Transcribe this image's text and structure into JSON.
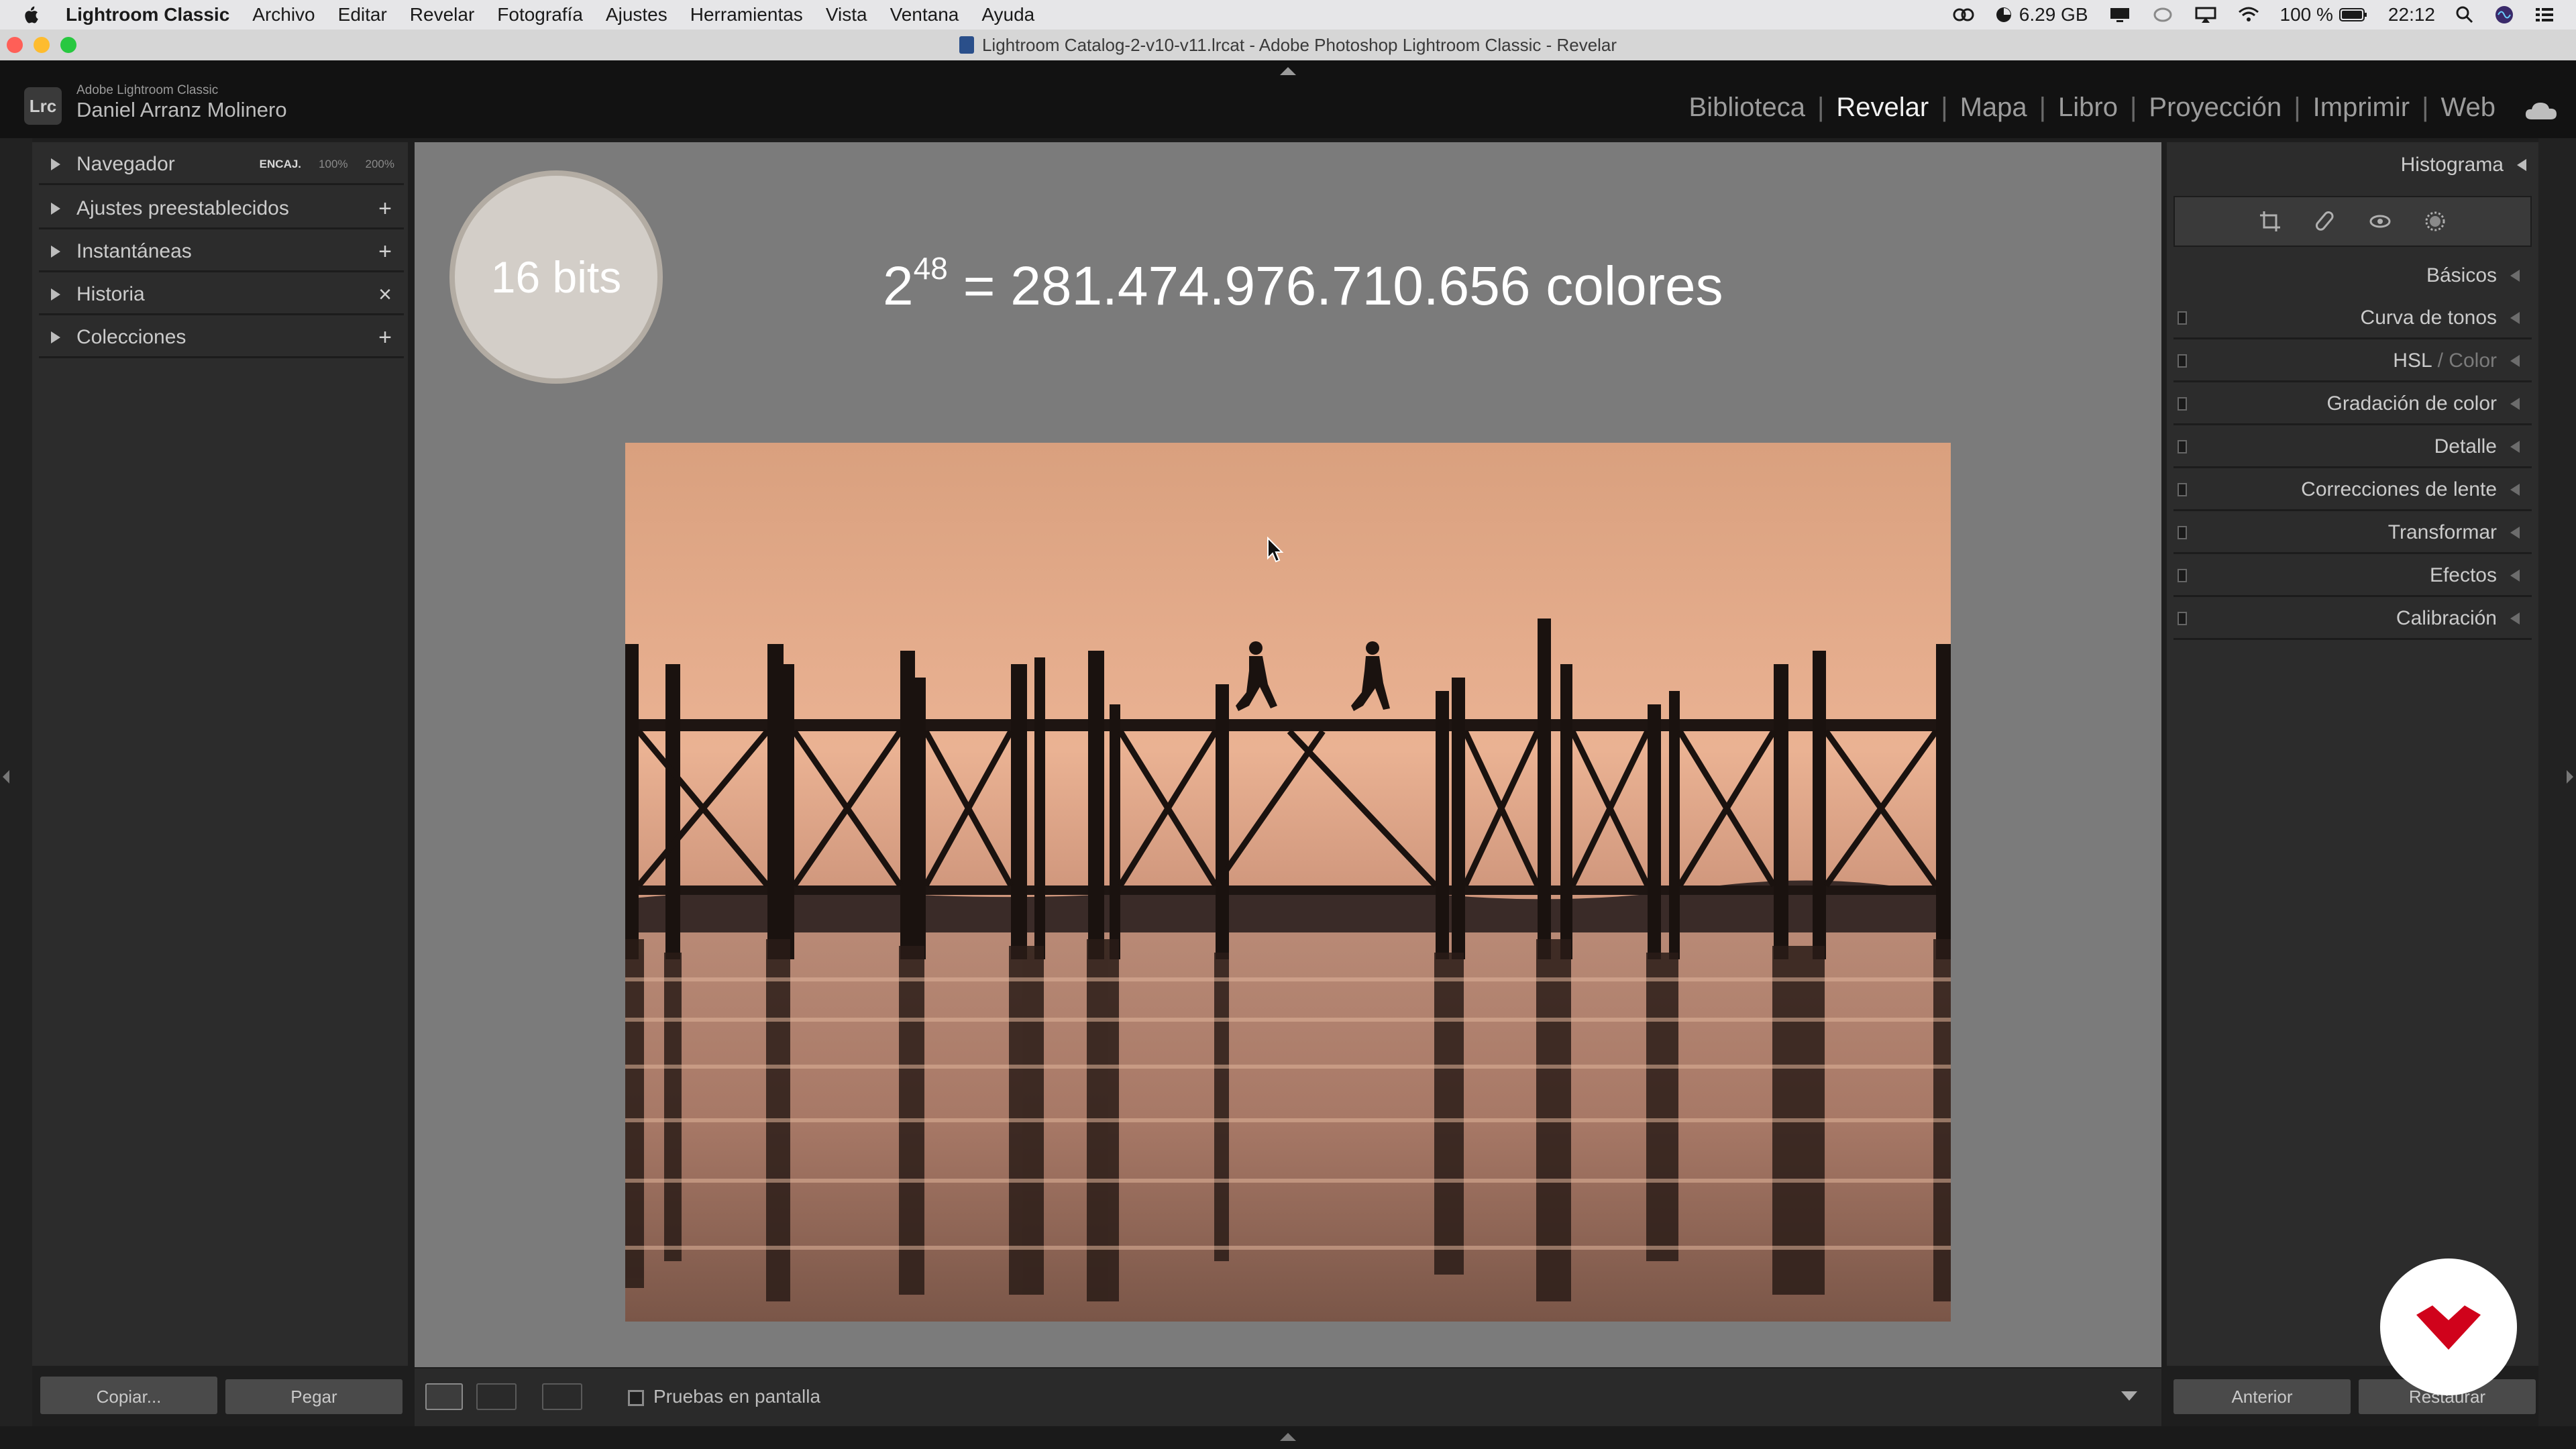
{
  "menubar": {
    "items": [
      "Lightroom Classic",
      "Archivo",
      "Editar",
      "Revelar",
      "Fotografía",
      "Ajustes",
      "Herramientas",
      "Vista",
      "Ventana",
      "Ayuda"
    ],
    "memory": "6.29 GB",
    "battery": "100 %",
    "time": "22:12"
  },
  "window": {
    "title": "Lightroom Catalog-2-v10-v11.lrcat - Adobe Photoshop Lightroom Classic - Revelar"
  },
  "identity": {
    "logo": "Lrc",
    "product": "Adobe Lightroom Classic",
    "user": "Daniel Arranz Molinero"
  },
  "modules": [
    "Biblioteca",
    "Revelar",
    "Mapa",
    "Libro",
    "Proyección",
    "Imprimir",
    "Web"
  ],
  "active_module": "Revelar",
  "left_panel": {
    "navigator": {
      "label": "Navegador",
      "zoom_options": [
        "ENCAJ.",
        "100%",
        "200%"
      ],
      "zoom_selected": "ENCAJ."
    },
    "sections": [
      {
        "label": "Ajustes preestablecidos",
        "action": "+"
      },
      {
        "label": "Instantáneas",
        "action": "+"
      },
      {
        "label": "Historia",
        "action": "×"
      },
      {
        "label": "Colecciones",
        "action": "+"
      }
    ],
    "copy_button": "Copiar...",
    "paste_button": "Pegar"
  },
  "center": {
    "badge": "16 bits",
    "formula": {
      "base": "2",
      "exponent": "48",
      "rest": "=  281.474.976.710.656 colores"
    }
  },
  "toolbar": {
    "soft_proof_label": "Pruebas en pantalla"
  },
  "right_panel": {
    "histogram": "Histograma",
    "sections": [
      "Básicos",
      "Curva de tonos",
      "HSL",
      "Gradación de color",
      "Detalle",
      "Correcciones de lente",
      "Transformar",
      "Efectos",
      "Calibración"
    ],
    "hsl_secondary": "/ Color",
    "previous_button": "Anterior",
    "reset_button": "Restaurar"
  },
  "colors": {
    "accent_red": "#d0021b",
    "center_bg": "#7b7b7b",
    "panel_bg": "#2c2c2c"
  }
}
